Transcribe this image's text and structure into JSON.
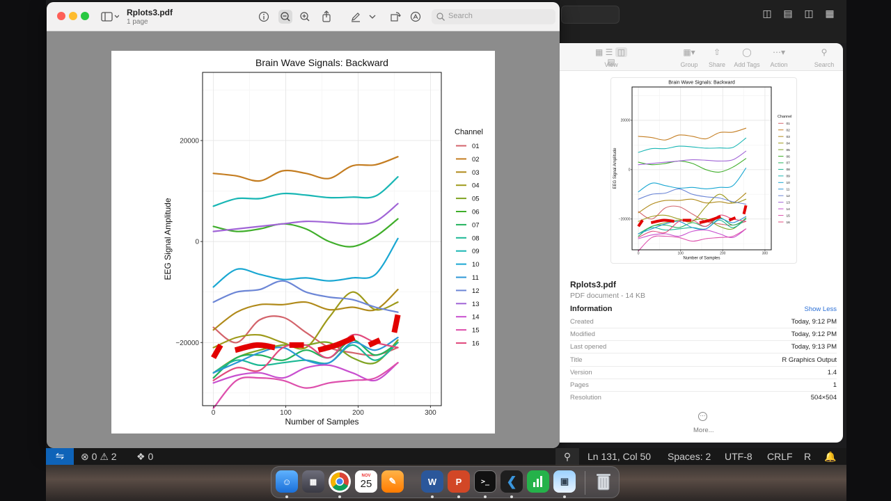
{
  "preview": {
    "doc_title": "Rplots3.pdf",
    "doc_subtitle": "1 page",
    "search_placeholder": "Search"
  },
  "chart_data": {
    "type": "line",
    "title": "Brain Wave Signals: Backward",
    "xlabel": "Number of Samples",
    "ylabel": "EEG Signal Amplitude",
    "xlim": [
      -15,
      315
    ],
    "ylim": [
      -32500,
      33500
    ],
    "x_ticks": [
      "0",
      "100",
      "200",
      "300"
    ],
    "y_ticks": [
      "20000",
      "0",
      "−20000"
    ],
    "legend_title": "Channel",
    "legend_position": "right",
    "grid": true,
    "x": [
      0,
      32,
      64,
      96,
      128,
      160,
      192,
      224,
      255
    ],
    "series": [
      {
        "name": "01",
        "color": "#d3636b",
        "values": [
          -17000,
          -20000,
          -15500,
          -15000,
          -18000,
          -21000,
          -22000,
          -22500,
          -21000
        ]
      },
      {
        "name": "02",
        "color": "#c47d21",
        "values": [
          13500,
          13000,
          12000,
          14000,
          13500,
          12500,
          15000,
          15200,
          16800
        ]
      },
      {
        "name": "03",
        "color": "#b08a1a",
        "values": [
          -17500,
          -14000,
          -12500,
          -12500,
          -12000,
          -13500,
          -13000,
          -13500,
          -9500
        ]
      },
      {
        "name": "04",
        "color": "#9e9a1a",
        "values": [
          -21000,
          -19000,
          -18500,
          -20000,
          -21000,
          -15000,
          -10000,
          -13500,
          -12000
        ]
      },
      {
        "name": "05",
        "color": "#7fa322",
        "values": [
          -26000,
          -23000,
          -21500,
          -20500,
          -20500,
          -20000,
          -23000,
          -24000,
          -19500
        ]
      },
      {
        "name": "06",
        "color": "#3fae2a",
        "values": [
          3000,
          2000,
          2500,
          3500,
          2500,
          0,
          -1000,
          1000,
          4500
        ]
      },
      {
        "name": "07",
        "color": "#22b25b",
        "values": [
          -27000,
          -23000,
          -22500,
          -23500,
          -21500,
          -23000,
          -19500,
          -22500,
          -20000
        ]
      },
      {
        "name": "08",
        "color": "#1bb894",
        "values": [
          -26000,
          -23500,
          -24500,
          -24000,
          -23500,
          -24000,
          -20500,
          -23500,
          -20000
        ]
      },
      {
        "name": "09",
        "color": "#18b6b4",
        "values": [
          7000,
          8500,
          8500,
          9500,
          9200,
          8700,
          8800,
          9000,
          12800
        ]
      },
      {
        "name": "10",
        "color": "#19a7d2",
        "values": [
          -9000,
          -5500,
          -6500,
          -7500,
          -7200,
          -7800,
          -7200,
          -6500,
          600
        ]
      },
      {
        "name": "11",
        "color": "#2c97d6",
        "values": [
          -26000,
          -24000,
          -22000,
          -21000,
          -23500,
          -24000,
          -20000,
          -21500,
          -19000
        ]
      },
      {
        "name": "12",
        "color": "#6c86d6",
        "values": [
          -12000,
          -10000,
          -9500,
          -7800,
          -10000,
          -11000,
          -11500,
          -13000,
          -14000
        ]
      },
      {
        "name": "13",
        "color": "#a064d6",
        "values": [
          2000,
          2500,
          3000,
          3500,
          4000,
          3800,
          3500,
          4000,
          7500
        ]
      },
      {
        "name": "14",
        "color": "#c84fcf",
        "values": [
          -28000,
          -26500,
          -26000,
          -27000,
          -25000,
          -24500,
          -26000,
          -27500,
          -24000
        ]
      },
      {
        "name": "15",
        "color": "#dd4fac",
        "values": [
          -33000,
          -27500,
          -27000,
          -27500,
          -29000,
          -28000,
          -27500,
          -27000,
          -24000
        ]
      },
      {
        "name": "16",
        "color": "#e14a7d",
        "values": [
          -27500,
          -25000,
          -25500,
          -21000,
          -20500,
          -23000,
          -18500,
          -20000,
          -21000
        ]
      }
    ],
    "red_overlay": [
      {
        "x": [
          0,
          10
        ],
        "values": [
          -23000,
          -20500
        ]
      },
      {
        "x": [
          30,
          60,
          85
        ],
        "values": [
          -21500,
          -20500,
          -21000
        ]
      },
      {
        "x": [
          105,
          125
        ],
        "values": [
          -20500,
          -20500
        ]
      },
      {
        "x": [
          145,
          170,
          195
        ],
        "values": [
          -21500,
          -20500,
          -19000
        ]
      },
      {
        "x": [
          215,
          230
        ],
        "values": [
          -20500,
          -19500
        ]
      },
      {
        "x": [
          250,
          255
        ],
        "values": [
          -18000,
          -14500
        ]
      }
    ]
  },
  "info": {
    "toolbar": {
      "view": "View",
      "group": "Group",
      "share": "Share",
      "tags": "Add Tags",
      "action": "Action",
      "search": "Search"
    },
    "file_name": "Rplots3.pdf",
    "file_kind": "PDF document - 14 KB",
    "section": "Information",
    "show_less": "Show Less",
    "rows": [
      {
        "k": "Created",
        "v": "Today, 9:12 PM"
      },
      {
        "k": "Modified",
        "v": "Today, 9:12 PM"
      },
      {
        "k": "Last opened",
        "v": "Today, 9:13 PM"
      },
      {
        "k": "Title",
        "v": "R Graphics Output"
      },
      {
        "k": "Version",
        "v": "1.4"
      },
      {
        "k": "Pages",
        "v": "1"
      },
      {
        "k": "Resolution",
        "v": "504×504"
      }
    ],
    "more": "More..."
  },
  "statusbar": {
    "errors": "0",
    "warnings": "2",
    "ports": "0",
    "position": "Ln 131, Col 50",
    "spaces": "Spaces: 2",
    "encoding": "UTF-8",
    "eol": "CRLF",
    "language": "R"
  },
  "dock": {
    "calendar_month": "NOV",
    "calendar_day": "25"
  }
}
